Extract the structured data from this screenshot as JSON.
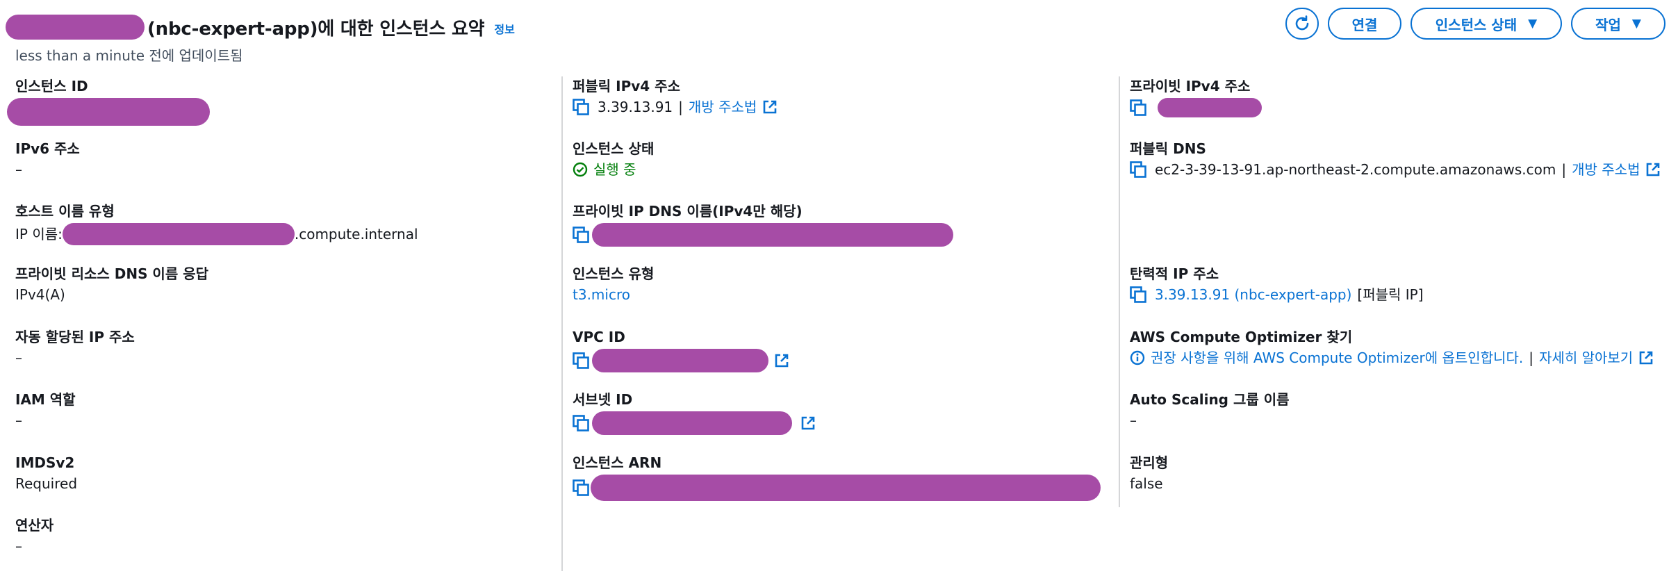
{
  "header": {
    "title_suffix": "(nbc-expert-app)에 대한 인스턴스 요약",
    "info_label": "정보",
    "updated_text": "less than a minute 전에 업데이트됨"
  },
  "actions": {
    "refresh_icon": "refresh-icon",
    "connect_label": "연결",
    "instance_state_label": "인스턴스 상태",
    "actions_label": "작업",
    "caret": "▼"
  },
  "col1": {
    "instance_id_label": "인스턴스 ID",
    "ipv6_label": "IPv6 주소",
    "ipv6_value": "–",
    "hostname_type_label": "호스트 이름 유형",
    "hostname_prefix": "IP 이름:",
    "hostname_suffix": ".compute.internal",
    "private_dns_answer_label": "프라이빗 리소스 DNS 이름 응답",
    "private_dns_answer_value": "IPv4(A)",
    "auto_ip_label": "자동 할당된 IP 주소",
    "auto_ip_value": "–",
    "iam_role_label": "IAM 역할",
    "iam_role_value": "–",
    "imdsv2_label": "IMDSv2",
    "imdsv2_value": "Required",
    "operator_label": "연산자",
    "operator_value": "–"
  },
  "col2": {
    "public_ipv4_label": "퍼블릭 IPv4 주소",
    "public_ipv4_value": "3.39.13.91",
    "open_address_link": "개방 주소법",
    "instance_state_label": "인스턴스 상태",
    "instance_state_value": "실행 중",
    "private_ip_dns_label": "프라이빗 IP DNS 이름(IPv4만 해당)",
    "instance_type_label": "인스턴스 유형",
    "instance_type_value": "t3.micro",
    "vpc_id_label": "VPC ID",
    "subnet_id_label": "서브넷 ID",
    "instance_arn_label": "인스턴스 ARN"
  },
  "col3": {
    "private_ipv4_label": "프라이빗 IPv4 주소",
    "public_dns_label": "퍼블릭 DNS",
    "public_dns_value": "ec2-3-39-13-91.ap-northeast-2.compute.amazonaws.com",
    "open_address_link": "개방 주소법",
    "elastic_ip_label": "탄력적 IP 주소",
    "elastic_ip_value": "3.39.13.91 (nbc-expert-app)",
    "elastic_ip_suffix": "[퍼블릭 IP]",
    "optimizer_label": "AWS Compute Optimizer 찾기",
    "optimizer_text": "권장 사항을 위해 AWS Compute Optimizer에 옵트인합니다.",
    "learn_more_link": "자세히 알아보기",
    "asg_label": "Auto Scaling 그룹 이름",
    "asg_value": "–",
    "managed_label": "관리형",
    "managed_value": "false"
  },
  "separator": "|",
  "colors": {
    "accent": "#0972d3",
    "success": "#037f0c",
    "redaction": "#a64ca6",
    "text": "#16191f"
  }
}
